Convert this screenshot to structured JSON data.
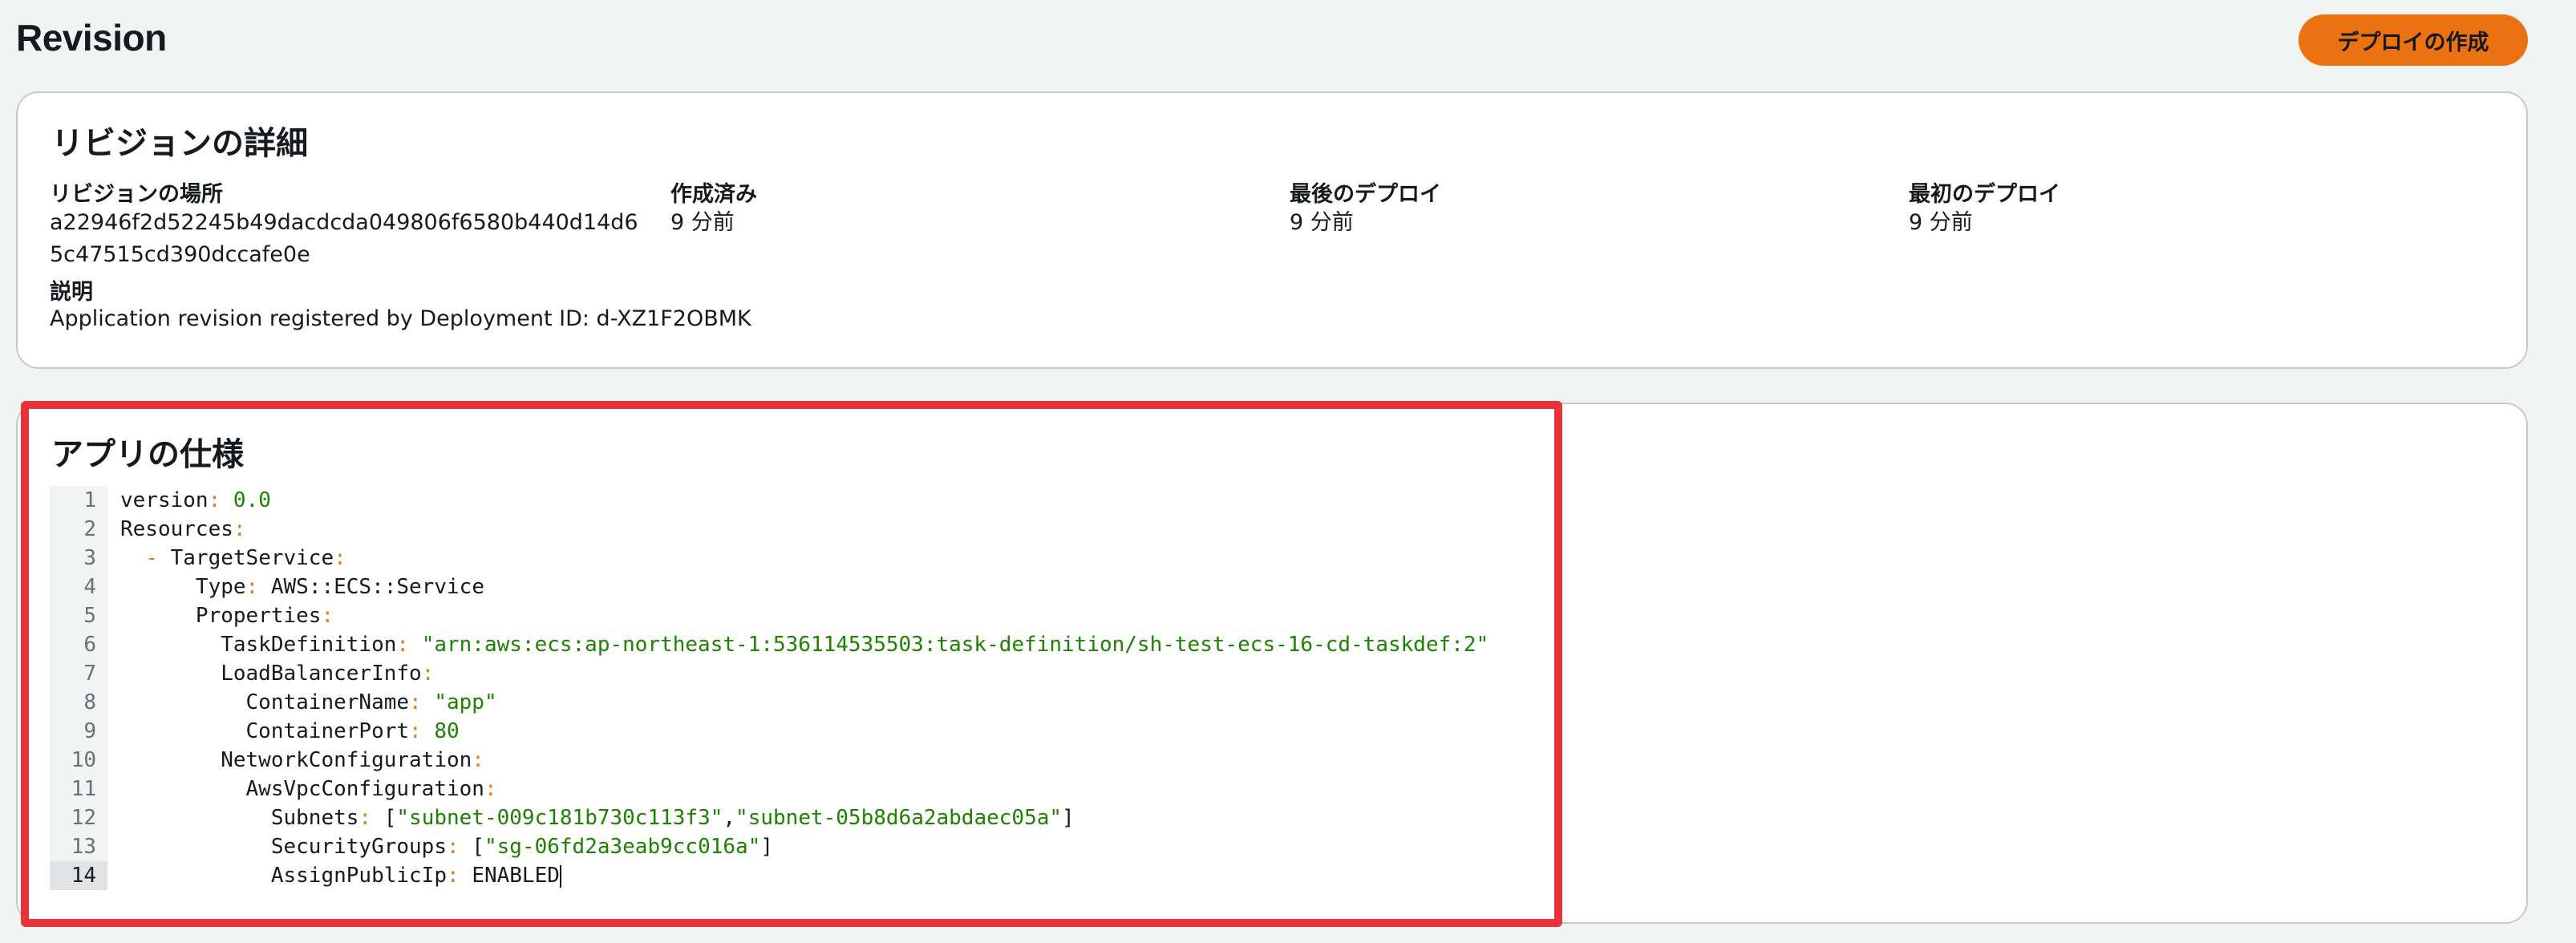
{
  "page": {
    "title": "Revision"
  },
  "actions": {
    "create_deployment": "デプロイの作成"
  },
  "details": {
    "title": "リビジョンの詳細",
    "location_label": "リビジョンの場所",
    "location_value": "a22946f2d52245b49dacdcda049806f6580b440d14d65c47515cd390dccafe0e",
    "created_label": "作成済み",
    "created_value": "9 分前",
    "last_deploy_label": "最後のデプロイ",
    "last_deploy_value": "9 分前",
    "first_deploy_label": "最初のデプロイ",
    "first_deploy_value": "9 分前",
    "description_label": "説明",
    "description_value": "Application revision registered by Deployment ID: d-XZ1F2OBMK"
  },
  "spec": {
    "title": "アプリの仕様",
    "active_line": 14,
    "lines": [
      {
        "n": "1",
        "tokens": [
          [
            "k",
            "version"
          ],
          [
            "p",
            ": "
          ],
          [
            "n",
            "0.0"
          ]
        ]
      },
      {
        "n": "2",
        "tokens": [
          [
            "k",
            "Resources"
          ],
          [
            "p",
            ":"
          ]
        ]
      },
      {
        "n": "3",
        "tokens": [
          [
            "k",
            "  "
          ],
          [
            "p",
            "- "
          ],
          [
            "k",
            "TargetService"
          ],
          [
            "p",
            ":"
          ]
        ]
      },
      {
        "n": "4",
        "tokens": [
          [
            "k",
            "      Type"
          ],
          [
            "p",
            ": "
          ],
          [
            "k",
            "AWS::ECS::Service"
          ]
        ]
      },
      {
        "n": "5",
        "tokens": [
          [
            "k",
            "      Properties"
          ],
          [
            "p",
            ":"
          ]
        ]
      },
      {
        "n": "6",
        "tokens": [
          [
            "k",
            "        TaskDefinition"
          ],
          [
            "p",
            ": "
          ],
          [
            "s",
            "\"arn:aws:ecs:ap-northeast-1:536114535503:task-definition/sh-test-ecs-16-cd-taskdef:2\""
          ]
        ]
      },
      {
        "n": "7",
        "tokens": [
          [
            "k",
            "        LoadBalancerInfo"
          ],
          [
            "p",
            ":"
          ]
        ]
      },
      {
        "n": "8",
        "tokens": [
          [
            "k",
            "          ContainerName"
          ],
          [
            "p",
            ": "
          ],
          [
            "s",
            "\"app\""
          ]
        ]
      },
      {
        "n": "9",
        "tokens": [
          [
            "k",
            "          ContainerPort"
          ],
          [
            "p",
            ": "
          ],
          [
            "n",
            "80"
          ]
        ]
      },
      {
        "n": "10",
        "tokens": [
          [
            "k",
            "        NetworkConfiguration"
          ],
          [
            "p",
            ":"
          ]
        ]
      },
      {
        "n": "11",
        "tokens": [
          [
            "k",
            "          AwsVpcConfiguration"
          ],
          [
            "p",
            ":"
          ]
        ]
      },
      {
        "n": "12",
        "tokens": [
          [
            "k",
            "            Subnets"
          ],
          [
            "p",
            ": "
          ],
          [
            "k",
            "["
          ],
          [
            "s",
            "\"subnet-009c181b730c113f3\""
          ],
          [
            "k",
            ","
          ],
          [
            "s",
            "\"subnet-05b8d6a2abdaec05a\""
          ],
          [
            "k",
            "]"
          ]
        ]
      },
      {
        "n": "13",
        "tokens": [
          [
            "k",
            "            SecurityGroups"
          ],
          [
            "p",
            ": "
          ],
          [
            "k",
            "["
          ],
          [
            "s",
            "\"sg-06fd2a3eab9cc016a\""
          ],
          [
            "k",
            "]"
          ]
        ]
      },
      {
        "n": "14",
        "tokens": [
          [
            "k",
            "            AssignPublicIp"
          ],
          [
            "p",
            ": "
          ],
          [
            "k",
            "ENABLED"
          ]
        ]
      }
    ]
  },
  "colors": {
    "accent_button": "#ec7211",
    "highlight_border": "#e8333b",
    "code_string": "#1d8102",
    "code_punct": "#e07b1a"
  }
}
